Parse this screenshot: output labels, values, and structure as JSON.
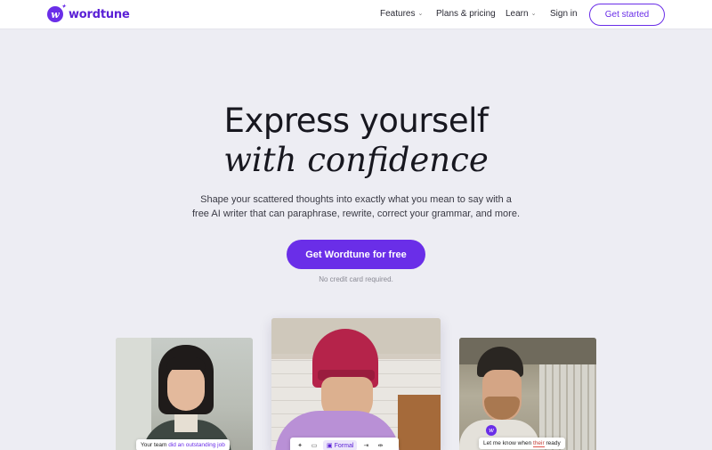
{
  "brand": {
    "name": "wordtune",
    "accent": "#6a2ee8"
  },
  "nav": {
    "items": [
      {
        "label": "Features",
        "has_dropdown": true
      },
      {
        "label": "Plans & pricing",
        "has_dropdown": false
      },
      {
        "label": "Learn",
        "has_dropdown": true
      },
      {
        "label": "Sign in",
        "has_dropdown": false
      }
    ],
    "cta": "Get started"
  },
  "hero": {
    "title_line1": "Express yourself",
    "title_line2": "with confidence",
    "subtitle_line1": "Shape your scattered thoughts into exactly what you mean to say with a",
    "subtitle_line2": "free AI writer that can paraphrase, rewrite, correct your grammar, and more.",
    "cta": "Get Wordtune for free",
    "note": "No credit card required."
  },
  "cards": {
    "left_chip_plain": "Your team ",
    "left_chip_highlight": "did an outstanding job",
    "toolbar_format": "Formal",
    "right_chip_before": "Let me know when ",
    "right_chip_error": "their",
    "right_chip_after": " ready"
  }
}
